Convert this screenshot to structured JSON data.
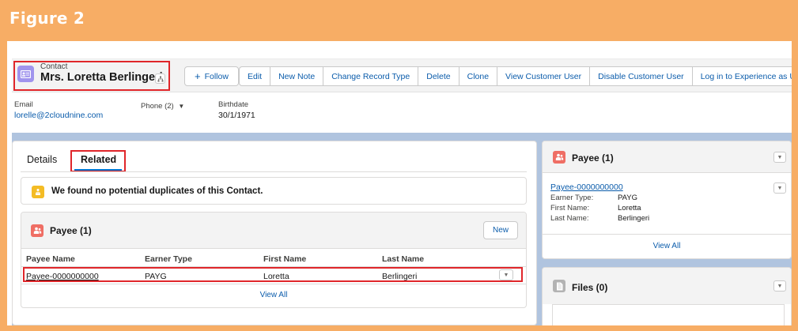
{
  "banner": {
    "title": "Figure 2"
  },
  "record": {
    "type": "Contact",
    "name": "Mrs. Loretta Berlingeri"
  },
  "actions": {
    "follow": "Follow",
    "buttons": [
      "Edit",
      "New Note",
      "Change Record Type",
      "Delete",
      "Clone",
      "View Customer User",
      "Disable Customer User",
      "Log in to Experience as User"
    ]
  },
  "fields": {
    "email_label": "Email",
    "email_value": "lorelle@2cloudnine.com",
    "phone_label": "Phone (2)",
    "birthdate_label": "Birthdate",
    "birthdate_value": "30/1/1971"
  },
  "tabs": {
    "details": "Details",
    "related": "Related"
  },
  "duplicates": {
    "message": "We found no potential duplicates of this Contact."
  },
  "payee_related": {
    "title": "Payee (1)",
    "new_label": "New",
    "columns": [
      "Payee Name",
      "Earner Type",
      "First Name",
      "Last Name"
    ],
    "rows": [
      {
        "payee_name": "Payee-0000000000",
        "earner_type": "PAYG",
        "first_name": "Loretta",
        "last_name": "Berlingeri"
      }
    ],
    "view_all": "View All"
  },
  "payee_side": {
    "title": "Payee (1)",
    "link": "Payee-0000000000",
    "earner_type_label": "Earner Type:",
    "earner_type_value": "PAYG",
    "first_name_label": "First Name:",
    "first_name_value": "Loretta",
    "last_name_label": "Last Name:",
    "last_name_value": "Berlingeri",
    "view_all": "View All"
  },
  "files": {
    "title": "Files (0)"
  },
  "colors": {
    "banner": "#f7ad65",
    "highlight": "#e0262a",
    "link": "#0b5cab",
    "contact_icon": "#a094ed",
    "payee_icon": "#ef6e64",
    "duplicate_icon": "#f4bc25",
    "files_icon": "#b3b3b3"
  },
  "icons": {
    "record": "contact-card-icon",
    "hierarchy": "hierarchy-icon",
    "follow": "plus-icon",
    "phone": "chevron-down-icon",
    "duplicates": "duplicate-person-icon",
    "payee": "payee-icon",
    "files": "file-icon"
  }
}
